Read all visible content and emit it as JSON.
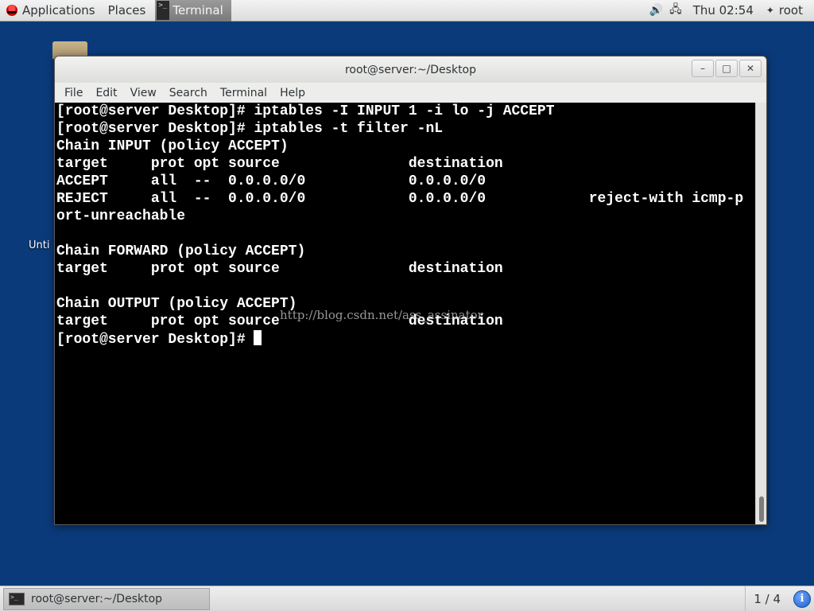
{
  "top_panel": {
    "applications_label": "Applications",
    "places_label": "Places",
    "task_label": "Terminal",
    "clock": "Thu 02:54",
    "user": "root"
  },
  "desktop": {
    "icon_label": "Unti"
  },
  "window": {
    "title": "root@server:~/Desktop",
    "controls": {
      "minimize": "–",
      "maximize": "□",
      "close": "✕"
    },
    "menu": [
      "File",
      "Edit",
      "View",
      "Search",
      "Terminal",
      "Help"
    ]
  },
  "terminal": {
    "lines": [
      "[root@server Desktop]# iptables -I INPUT 1 -i lo -j ACCEPT",
      "[root@server Desktop]# iptables -t filter -nL",
      "Chain INPUT (policy ACCEPT)",
      "target     prot opt source               destination         ",
      "ACCEPT     all  --  0.0.0.0/0            0.0.0.0/0           ",
      "REJECT     all  --  0.0.0.0/0            0.0.0.0/0            reject-with icmp-p",
      "ort-unreachable",
      "",
      "Chain FORWARD (policy ACCEPT)",
      "target     prot opt source               destination         ",
      "",
      "Chain OUTPUT (policy ACCEPT)",
      "target     prot opt source               destination         "
    ],
    "prompt": "[root@server Desktop]# ",
    "watermark": "http://blog.csdn.net/ass_assinator"
  },
  "bottom_panel": {
    "task_label": "root@server:~/Desktop",
    "workspace": "1 / 4",
    "info_glyph": "i"
  },
  "icons": {
    "logo": "redhat-logo-icon",
    "volume": "speaker-icon",
    "network": "network-icon",
    "user": "user-icon",
    "terminal": "terminal-icon",
    "notifications": "info-icon"
  }
}
